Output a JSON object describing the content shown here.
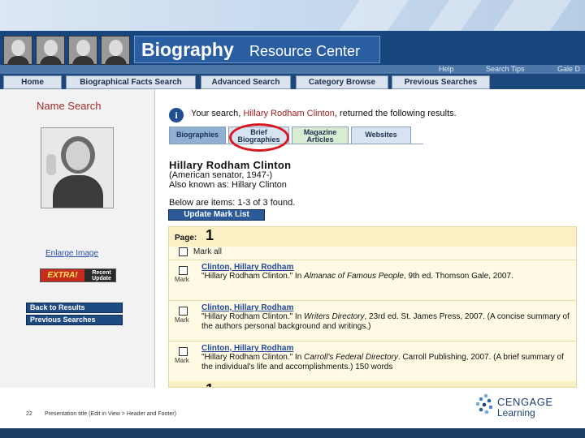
{
  "app": {
    "title_main": "Biography",
    "title_sub": "Resource Center"
  },
  "util_links": [
    "Help",
    "Search Tips",
    "Gale D"
  ],
  "nav_tabs": [
    "Home",
    "Biographical Facts Search",
    "Advanced Search",
    "Category Browse",
    "Previous Searches"
  ],
  "sidebar": {
    "heading": "Name Search",
    "enlarge_link": "Enlarge Image",
    "badge_extra": "EXTRA!",
    "badge_recent": "Recent Update",
    "back_button": "Back to Results",
    "previous_button": "Previous Searches"
  },
  "main": {
    "result_prefix": "Your search,",
    "result_name": "Hillary Rodham Clinton",
    "result_suffix": ", returned the following results.",
    "tabs": [
      {
        "label": "Biographies"
      },
      {
        "label_line1": "Brief",
        "label_line2": "Biographies"
      },
      {
        "label_line1": "Magazine",
        "label_line2": "Articles"
      },
      {
        "label": "Websites"
      }
    ],
    "person_name": "Hillary Rodham Clinton",
    "lifespan": "(American senator, 1947-)",
    "aka": "Also known as: Hillary Clinton",
    "found_text": "Below are items: 1-3 of 3 found.",
    "update_button": "Update Mark List",
    "page_label": "Page:",
    "page_number": "1",
    "mark_all": "Mark all",
    "mark_label": "Mark",
    "entries": [
      {
        "title": "Clinton, Hillary Rodham",
        "cite_pre": "\"Hillary Rodham Clinton.\" In ",
        "cite_italic": "Almanac of Famous People",
        "cite_post": ", 9th ed. Thomson Gale, 2007."
      },
      {
        "title": "Clinton, Hillary Rodham",
        "cite_pre": "\"Hillary Rodham Clinton.\" In ",
        "cite_italic": "Writers Directory",
        "cite_post": ", 23rd ed. St. James Press, 2007. (A concise summary of the authors personal background and writings.)"
      },
      {
        "title": "Clinton, Hillary Rodham",
        "cite_pre": "\"Hillary Rodham Clinton.\" In ",
        "cite_italic": "Carroll's Federal Directory",
        "cite_post": ". Carroll Publishing, 2007. (A brief summary of the individual's life and accomplishments.)   150 words"
      }
    ]
  },
  "footer": {
    "slide_number": "22",
    "text": "Presentation title (Edit in View > Header and Footer)",
    "brand_line1": "CENGAGE",
    "brand_line2": "Learning"
  },
  "colors": {
    "banner": "#17457e",
    "nav": "#1b477d",
    "highlight_circle": "#d71920",
    "result_name": "#a31f1f",
    "link": "#22489a"
  }
}
